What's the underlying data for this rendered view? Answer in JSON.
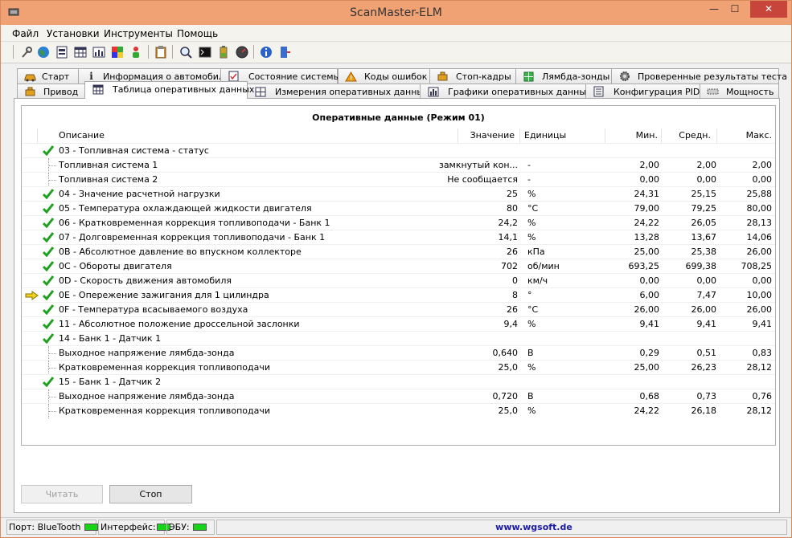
{
  "window": {
    "title": "ScanMaster-ELM",
    "min": "—",
    "max": "☐",
    "close": "✕"
  },
  "menu": [
    "Файл",
    "Установки",
    "Инструменты",
    "Помощь"
  ],
  "toolbar_icons": [
    "wrench-icon",
    "globe-icon",
    "car-info-icon",
    "table-icon",
    "chart-icon",
    "grid-color-icon",
    "person-icon",
    "clipboard-icon",
    "monitor-search-icon",
    "terminal-icon",
    "battery-icon",
    "gauge-icon",
    "info-icon",
    "exit-icon"
  ],
  "tabs_row1": [
    {
      "label": "Старт",
      "icon": "car-icon"
    },
    {
      "label": "Информация о автомобиле",
      "icon": "info-icon"
    },
    {
      "label": "Состояние системы",
      "icon": "checklist-icon"
    },
    {
      "label": "Коды ошибок",
      "icon": "warning-icon"
    },
    {
      "label": "Стоп-кадры",
      "icon": "engine-icon"
    },
    {
      "label": "Лямбда-зонды",
      "icon": "grid-icon"
    },
    {
      "label": "Проверенные результаты теста",
      "icon": "gear-icon"
    }
  ],
  "tabs_row2": [
    {
      "label": "Привод",
      "icon": "engine-icon"
    },
    {
      "label": "Таблица оперативных данных",
      "icon": "table-icon",
      "active": true
    },
    {
      "label": "Измерения оперативных данных",
      "icon": "measure-icon"
    },
    {
      "label": "Графики оперативных данных",
      "icon": "chart-icon"
    },
    {
      "label": "Конфигурация PID",
      "icon": "config-icon"
    },
    {
      "label": "Мощность",
      "icon": "power-icon"
    }
  ],
  "grid": {
    "title": "Оперативные данные (Режим 01)",
    "headers": {
      "desc": "Описание",
      "value": "Значение",
      "unit": "Единицы",
      "min": "Мин.",
      "avg": "Средн.",
      "max": "Макс."
    },
    "rows": [
      {
        "desc": "03 - Топливная система - статус",
        "check": true,
        "sub": false,
        "value": "",
        "unit": "",
        "min": "",
        "avg": "",
        "max": ""
      },
      {
        "desc": "Топливная система 1",
        "check": false,
        "sub": true,
        "value": "замкнутый кон...",
        "unit": "-",
        "min": "2,00",
        "avg": "2,00",
        "max": "2,00"
      },
      {
        "desc": "Топливная система 2",
        "check": false,
        "sub": true,
        "value": "Не сообщается",
        "unit": "-",
        "min": "0,00",
        "avg": "0,00",
        "max": "0,00"
      },
      {
        "desc": "04 - Значение расчетной нагрузки",
        "check": true,
        "sub": false,
        "value": "25",
        "unit": "%",
        "min": "24,31",
        "avg": "25,15",
        "max": "25,88"
      },
      {
        "desc": "05 - Температура охлаждающей жидкости двигателя",
        "check": true,
        "sub": false,
        "value": "80",
        "unit": "°C",
        "min": "79,00",
        "avg": "79,25",
        "max": "80,00"
      },
      {
        "desc": "06 - Кратковременная коррекция топливоподачи - Банк 1",
        "check": true,
        "sub": false,
        "value": "24,2",
        "unit": "%",
        "min": "24,22",
        "avg": "26,05",
        "max": "28,13"
      },
      {
        "desc": "07 - Долговременная коррекция топливоподачи - Банк 1",
        "check": true,
        "sub": false,
        "value": "14,1",
        "unit": "%",
        "min": "13,28",
        "avg": "13,67",
        "max": "14,06"
      },
      {
        "desc": "0B - Абсолютное давление во впускном коллекторе",
        "check": true,
        "sub": false,
        "value": "26",
        "unit": "кПа",
        "min": "25,00",
        "avg": "25,38",
        "max": "26,00"
      },
      {
        "desc": "0C - Обороты двигателя",
        "check": true,
        "sub": false,
        "value": "702",
        "unit": "об/мин",
        "min": "693,25",
        "avg": "699,38",
        "max": "708,25"
      },
      {
        "desc": "0D - Скорость движения автомобиля",
        "check": true,
        "sub": false,
        "value": "0",
        "unit": "км/ч",
        "min": "0,00",
        "avg": "0,00",
        "max": "0,00"
      },
      {
        "desc": "0E - Опережение зажигания для 1 цилиндра",
        "check": true,
        "sub": false,
        "arrow": true,
        "value": "8",
        "unit": "°",
        "min": "6,00",
        "avg": "7,47",
        "max": "10,00"
      },
      {
        "desc": "0F - Температура всасываемого воздуха",
        "check": true,
        "sub": false,
        "value": "26",
        "unit": "°C",
        "min": "26,00",
        "avg": "26,00",
        "max": "26,00"
      },
      {
        "desc": "11 - Абсолютное положение дроссельной заслонки",
        "check": true,
        "sub": false,
        "value": "9,4",
        "unit": "%",
        "min": "9,41",
        "avg": "9,41",
        "max": "9,41"
      },
      {
        "desc": "14 - Банк 1 - Датчик 1",
        "check": true,
        "sub": false,
        "value": "",
        "unit": "",
        "min": "",
        "avg": "",
        "max": ""
      },
      {
        "desc": "Выходное напряжение лямбда-зонда",
        "check": false,
        "sub": true,
        "value": "0,640",
        "unit": "В",
        "min": "0,29",
        "avg": "0,51",
        "max": "0,83"
      },
      {
        "desc": "Кратковременная коррекция топливоподачи",
        "check": false,
        "sub": true,
        "value": "25,0",
        "unit": "%",
        "min": "25,00",
        "avg": "26,23",
        "max": "28,12"
      },
      {
        "desc": "15 - Банк 1 - Датчик 2",
        "check": true,
        "sub": false,
        "value": "",
        "unit": "",
        "min": "",
        "avg": "",
        "max": ""
      },
      {
        "desc": "Выходное напряжение лямбда-зонда",
        "check": false,
        "sub": true,
        "value": "0,720",
        "unit": "В",
        "min": "0,68",
        "avg": "0,73",
        "max": "0,76"
      },
      {
        "desc": "Кратковременная коррекция топливоподачи",
        "check": false,
        "sub": true,
        "value": "25,0",
        "unit": "%",
        "min": "24,22",
        "avg": "26,18",
        "max": "28,12"
      }
    ]
  },
  "buttons": {
    "read": "Читать",
    "stop": "Стоп"
  },
  "status": {
    "port": "Порт: BlueTooth",
    "interface": "Интерфейс:",
    "ecu": "ЭБУ:",
    "website": "www.wgsoft.de"
  },
  "colors": {
    "titlebar": "#f0a275",
    "close": "#c7453a",
    "led": "#18d418",
    "check": "#1fa01f",
    "arrow": "#f2d21a",
    "link": "#1a1aa8"
  }
}
